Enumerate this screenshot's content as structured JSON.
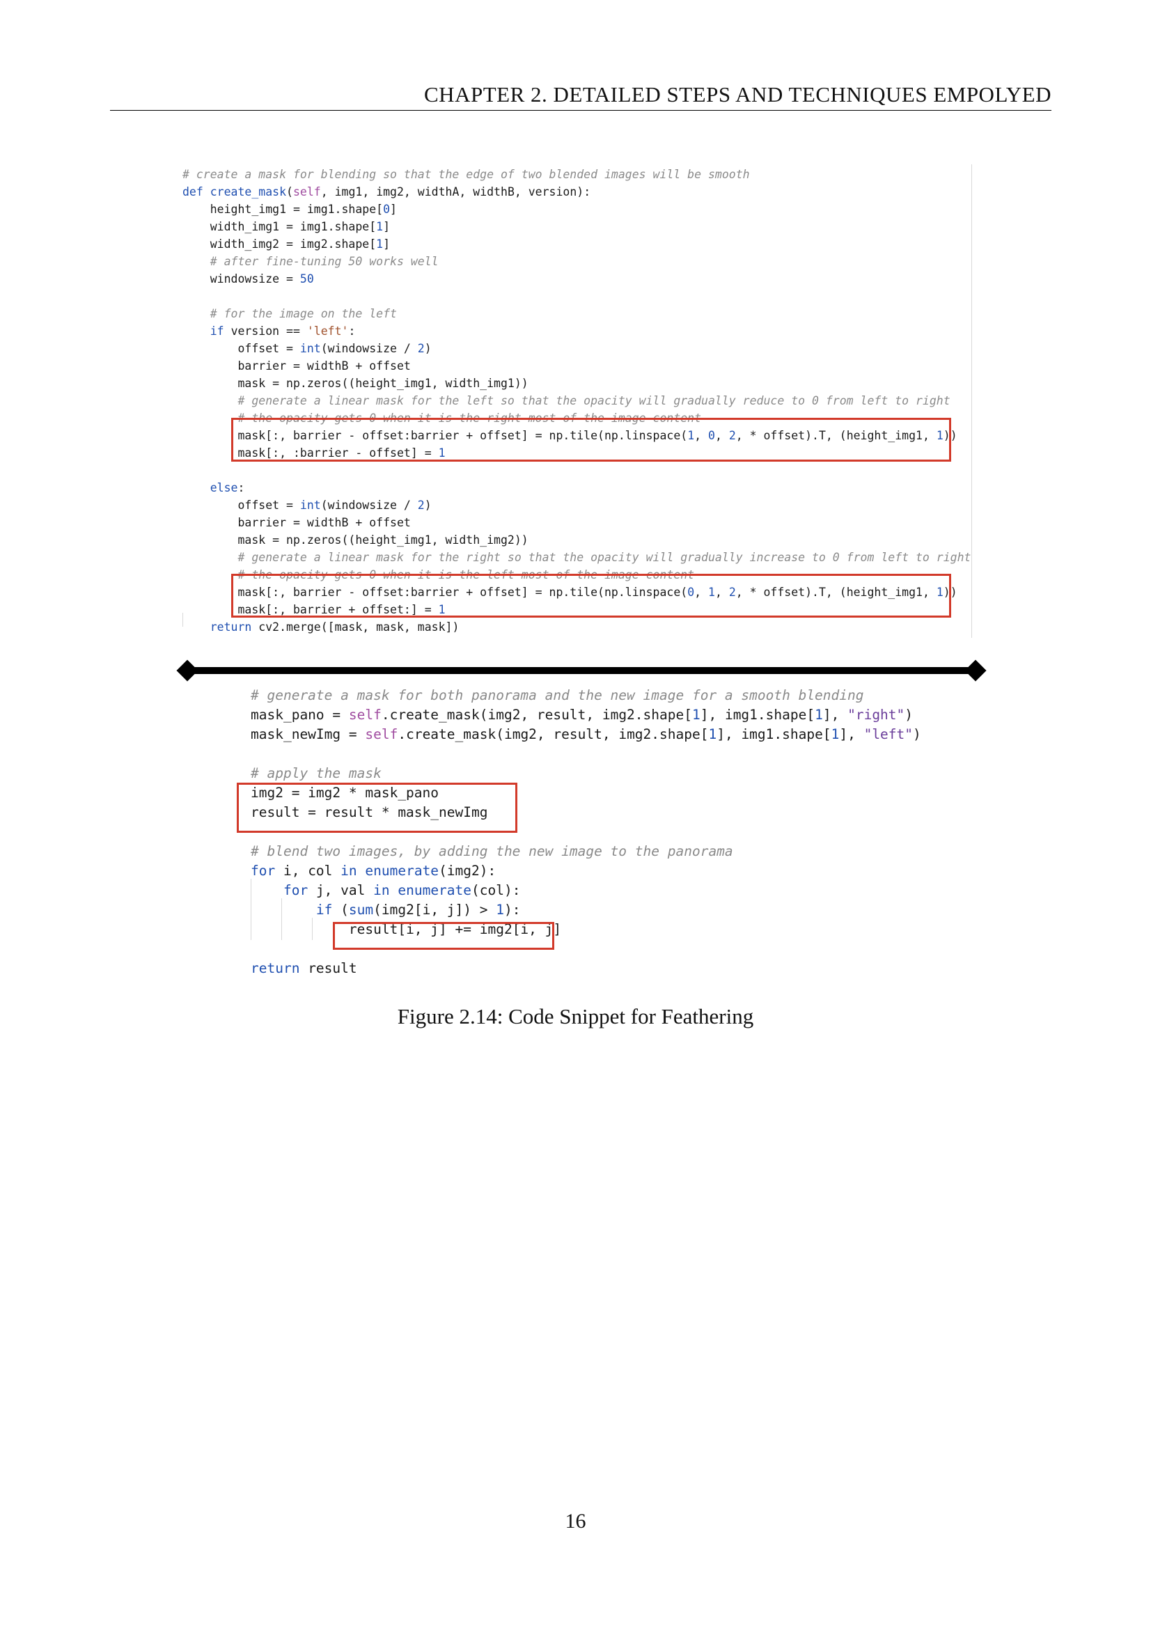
{
  "header": {
    "chapter": "CHAPTER 2.  DETAILED STEPS AND TECHNIQUES EMPOLYED"
  },
  "snippet_top": [
    [
      0,
      [
        [
          "cm",
          "# create a mask for blending so that the edge of two blended images will be smooth"
        ]
      ]
    ],
    [
      0,
      [
        [
          "kw",
          "def "
        ],
        [
          "fn",
          "create_mask"
        ],
        [
          "",
          "("
        ],
        [
          "self",
          "self"
        ],
        [
          "",
          ", img1, img2, "
        ],
        [
          "",
          "widthA"
        ],
        [
          "",
          ", widthB, version):"
        ]
      ]
    ],
    [
      4,
      [
        [
          "",
          "height_img1 = img1.shape["
        ],
        [
          "num",
          "0"
        ],
        [
          "",
          "]"
        ]
      ]
    ],
    [
      4,
      [
        [
          "",
          "width_img1 = img1.shape["
        ],
        [
          "num",
          "1"
        ],
        [
          "",
          "]"
        ]
      ]
    ],
    [
      4,
      [
        [
          "",
          "width_img2 = img2.shape["
        ],
        [
          "num",
          "1"
        ],
        [
          "",
          "]"
        ]
      ]
    ],
    [
      4,
      [
        [
          "cm",
          "# after fine-tuning 50 works well"
        ]
      ]
    ],
    [
      4,
      [
        [
          "",
          "windowsize = "
        ],
        [
          "num",
          "50"
        ]
      ]
    ],
    [
      0,
      [
        [
          "",
          ""
        ]
      ]
    ],
    [
      4,
      [
        [
          "cm",
          "# for the image on the left"
        ]
      ]
    ],
    [
      4,
      [
        [
          "kw",
          "if "
        ],
        [
          "",
          "version == "
        ],
        [
          "str",
          "'left'"
        ],
        [
          "",
          ":"
        ]
      ]
    ],
    [
      8,
      [
        [
          "",
          "offset = "
        ],
        [
          "fn",
          "int"
        ],
        [
          "",
          "(windowsize / "
        ],
        [
          "num",
          "2"
        ],
        [
          "",
          ")"
        ]
      ]
    ],
    [
      8,
      [
        [
          "",
          "barrier = widthB + offset"
        ]
      ]
    ],
    [
      8,
      [
        [
          "",
          "mask = np.zeros((height_img1, width_img1))"
        ]
      ]
    ],
    [
      8,
      [
        [
          "cm",
          "# generate a linear mask for the left so that the opacity will gradually reduce to 0 from left to right"
        ]
      ]
    ],
    [
      8,
      [
        [
          "cm",
          "# the opacity gets 0 when it is the right-most of the image content"
        ]
      ]
    ],
    [
      8,
      [
        [
          "",
          "mask[:, barrier - offset:barrier + offset] = np.tile(np.linspace("
        ],
        [
          "num",
          "1"
        ],
        [
          "",
          ", "
        ],
        [
          "num",
          "0"
        ],
        [
          "",
          ", "
        ],
        [
          "num",
          "2"
        ],
        [
          "",
          ", * offset).T, (height_img1, "
        ],
        [
          "num",
          "1"
        ],
        [
          "",
          "))"
        ]
      ]
    ],
    [
      8,
      [
        [
          "",
          "mask[:, :barrier - offset] = "
        ],
        [
          "num",
          "1"
        ]
      ]
    ],
    [
      0,
      [
        [
          "",
          ""
        ]
      ]
    ],
    [
      4,
      [
        [
          "kw",
          "else"
        ],
        [
          "",
          ":"
        ]
      ]
    ],
    [
      8,
      [
        [
          "",
          "offset = "
        ],
        [
          "fn",
          "int"
        ],
        [
          "",
          "(windowsize / "
        ],
        [
          "num",
          "2"
        ],
        [
          "",
          ")"
        ]
      ]
    ],
    [
      8,
      [
        [
          "",
          "barrier = widthB + offset"
        ]
      ]
    ],
    [
      8,
      [
        [
          "",
          "mask = np.zeros((height_img1, width_img2))"
        ]
      ]
    ],
    [
      8,
      [
        [
          "cm",
          "# generate a linear mask for the right so that the opacity will gradually increase to 0 from left to right"
        ]
      ]
    ],
    [
      8,
      [
        [
          "cm",
          "# the opacity gets 0 when it is the left-most of the image content"
        ]
      ]
    ],
    [
      8,
      [
        [
          "",
          "mask[:, barrier - offset:barrier + offset] = np.tile(np.linspace("
        ],
        [
          "num",
          "0"
        ],
        [
          "",
          ", "
        ],
        [
          "num",
          "1"
        ],
        [
          "",
          ", "
        ],
        [
          "num",
          "2"
        ],
        [
          "",
          ", * offset).T, (height_img1, "
        ],
        [
          "num",
          "1"
        ],
        [
          "",
          "))"
        ]
      ]
    ],
    [
      8,
      [
        [
          "",
          "mask[:, barrier + offset:] = "
        ],
        [
          "num",
          "1"
        ]
      ]
    ],
    [
      4,
      [
        [
          "kw",
          "return "
        ],
        [
          "",
          "cv2.merge([mask, mask, mask])"
        ]
      ]
    ]
  ],
  "snippet_bottom": [
    [
      0,
      [
        [
          "cm",
          "# generate a mask for both panorama and the new image for a smooth blending"
        ]
      ]
    ],
    [
      0,
      [
        [
          "",
          "mask_pano = "
        ],
        [
          "self",
          "self"
        ],
        [
          "",
          ".create_mask(img2, result, img2.shape["
        ],
        [
          "num",
          "1"
        ],
        [
          "",
          "], img1.shape["
        ],
        [
          "num",
          "1"
        ],
        [
          "",
          "], "
        ],
        [
          "str2",
          "\"right\""
        ],
        [
          "",
          ")"
        ]
      ]
    ],
    [
      0,
      [
        [
          "",
          "mask_newImg = "
        ],
        [
          "self",
          "self"
        ],
        [
          "",
          ".create_mask(img2, result, img2.shape["
        ],
        [
          "num",
          "1"
        ],
        [
          "",
          "], img1.shape["
        ],
        [
          "num",
          "1"
        ],
        [
          "",
          "], "
        ],
        [
          "str2",
          "\"left\""
        ],
        [
          "",
          ")"
        ]
      ]
    ],
    [
      0,
      [
        [
          "",
          ""
        ]
      ]
    ],
    [
      0,
      [
        [
          "cm",
          "# apply the mask"
        ]
      ]
    ],
    [
      0,
      [
        [
          "",
          "img2 = img2 * mask_pano"
        ]
      ]
    ],
    [
      0,
      [
        [
          "",
          "result = result * mask_newImg"
        ]
      ]
    ],
    [
      0,
      [
        [
          "",
          ""
        ]
      ]
    ],
    [
      0,
      [
        [
          "cm",
          "# blend two images, by adding the new image to the panorama"
        ]
      ]
    ],
    [
      0,
      [
        [
          "kw",
          "for "
        ],
        [
          "",
          "i, col "
        ],
        [
          "kw",
          "in "
        ],
        [
          "fn",
          "enumerate"
        ],
        [
          "",
          "(img2):"
        ]
      ]
    ],
    [
      4,
      [
        [
          "kw",
          "for "
        ],
        [
          "",
          "j, val "
        ],
        [
          "kw",
          "in "
        ],
        [
          "fn",
          "enumerate"
        ],
        [
          "",
          "(col):"
        ]
      ]
    ],
    [
      8,
      [
        [
          "kw",
          "if "
        ],
        [
          "",
          "("
        ],
        [
          "fn",
          "sum"
        ],
        [
          "",
          "(img2[i, j]) > "
        ],
        [
          "num",
          "1"
        ],
        [
          "",
          "):"
        ]
      ]
    ],
    [
      12,
      [
        [
          "",
          "result[i, j] += img2[i, j]"
        ]
      ]
    ],
    [
      0,
      [
        [
          "",
          ""
        ]
      ]
    ],
    [
      0,
      [
        [
          "kw",
          "return "
        ],
        [
          "",
          "result"
        ]
      ]
    ]
  ],
  "caption": "Figure 2.14: Code Snippet for Feathering",
  "page_number": "16"
}
